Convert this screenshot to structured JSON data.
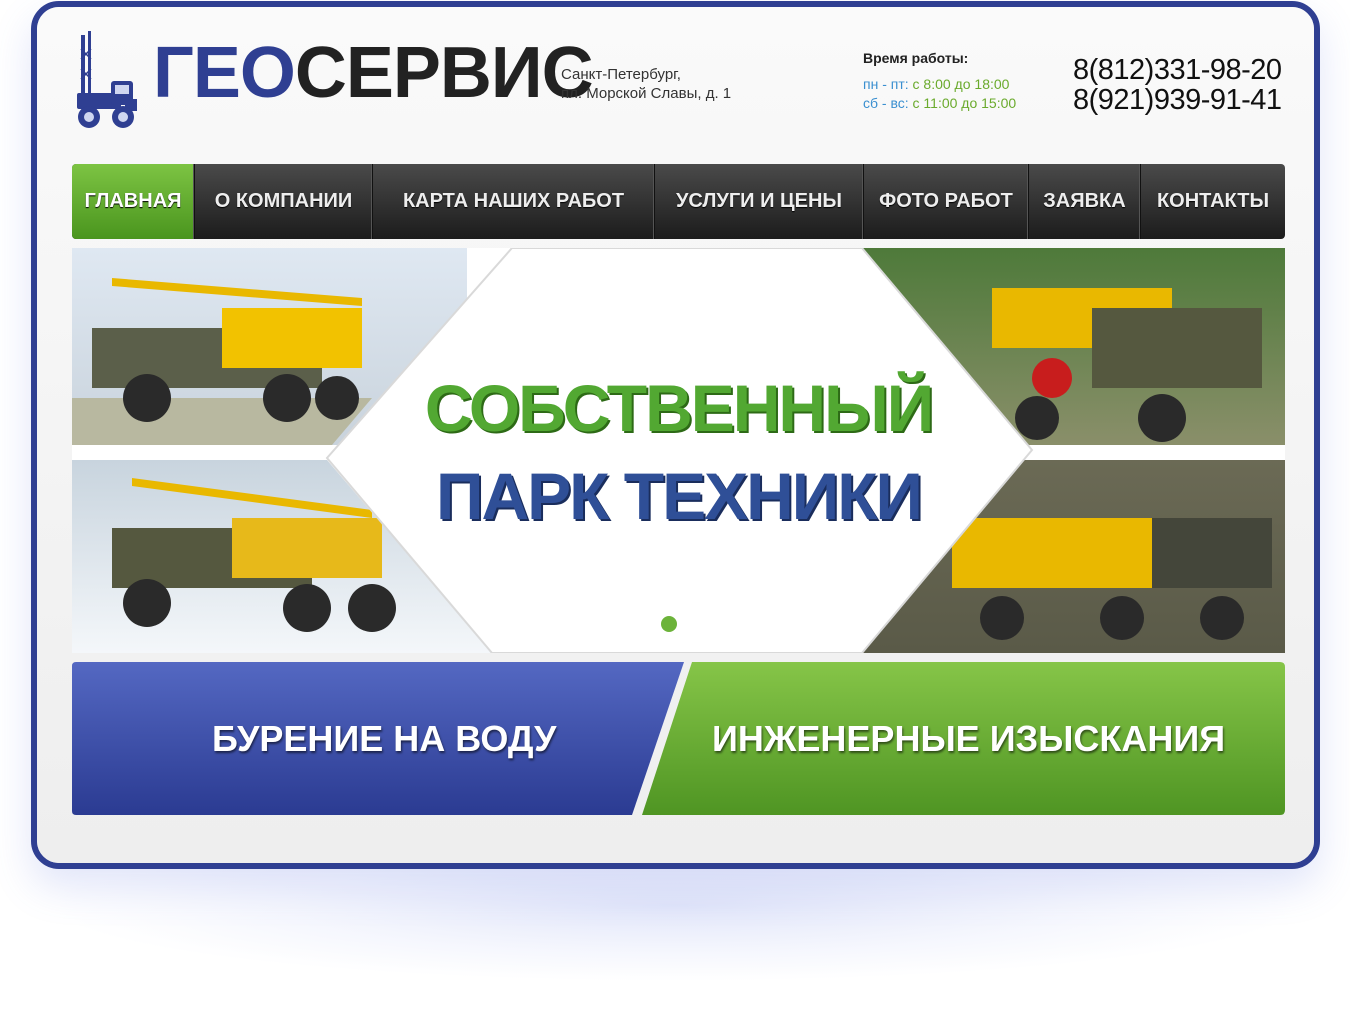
{
  "header": {
    "brand_part1": "ГЕО",
    "brand_part2": "СЕРВИС",
    "address_line1": "Санкт-Петербург,",
    "address_line2": "пл. Морской Славы, д. 1",
    "hours_title": "Время работы:",
    "hours_weekdays_days": "пн - пт:",
    "hours_weekdays_time": " с 8:00 до 18:00",
    "hours_weekend_days": "сб - вс:",
    "hours_weekend_time": " с 11:00 до 15:00",
    "phone1": "8(812)331-98-20",
    "phone2": "8(921)939-91-41"
  },
  "nav": {
    "items": [
      {
        "label": "ГЛАВНАЯ",
        "active": true
      },
      {
        "label": "О КОМПАНИИ"
      },
      {
        "label": "КАРТА НАШИХ РАБОТ"
      },
      {
        "label": "УСЛУГИ И ЦЕНЫ"
      },
      {
        "label": "ФОТО РАБОТ"
      },
      {
        "label": "ЗАЯВКА"
      },
      {
        "label": "КОНТАКТЫ"
      }
    ]
  },
  "slider": {
    "headline_line1": "СОБСТВЕННЫЙ",
    "headline_line2": "ПАРК ТЕХНИКИ"
  },
  "banners": {
    "left_label": "БУРЕНИЕ НА ВОДУ",
    "right_label": "ИНЖЕНЕРНЫЕ ИЗЫСКАНИЯ"
  },
  "colors": {
    "brand_blue": "#2f3f92",
    "brand_green": "#6cb33a",
    "nav_dark": "#2a2a2a"
  }
}
